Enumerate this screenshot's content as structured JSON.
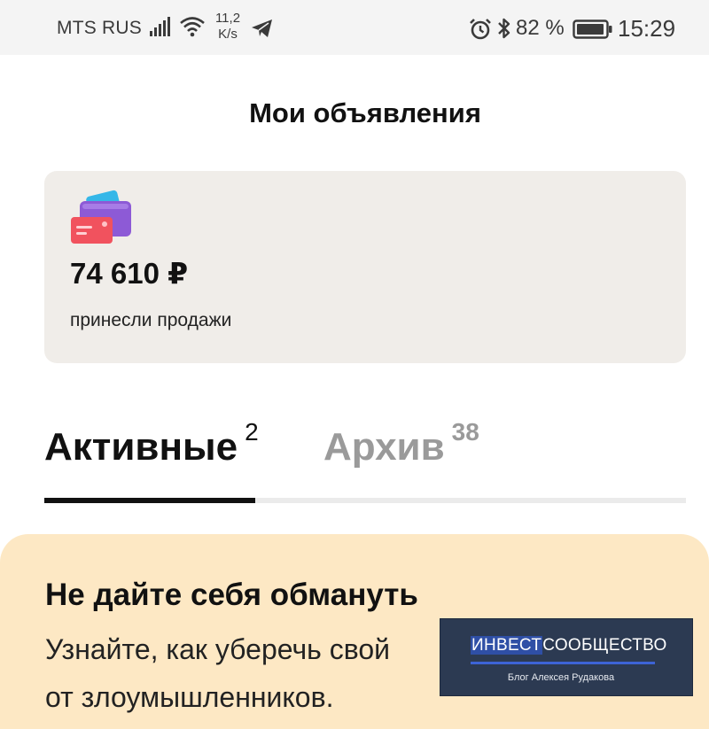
{
  "status_bar": {
    "carrier": "MTS RUS",
    "speed_value": "11,2",
    "speed_unit": "K/s",
    "battery": "82 %",
    "time": "15:29",
    "icons": [
      "signal-icon",
      "wifi-icon",
      "telegram-icon",
      "alarm-icon",
      "bluetooth-icon",
      "battery-icon"
    ]
  },
  "header": {
    "title": "Мои объявления"
  },
  "sales": {
    "icon": "wallet-cards-icon",
    "amount": "74 610 ₽",
    "caption": "принесли продажи"
  },
  "tabs": [
    {
      "label": "Активные",
      "count": "2",
      "active": true
    },
    {
      "label": "Архив",
      "count": "38",
      "active": false
    }
  ],
  "notice": {
    "title": "Не дайте себя обмануть",
    "line1": "Узнайте, как уберечь свой",
    "line2": "от злоумышленников."
  },
  "watermark": {
    "title_part1": "ИНВЕСТ",
    "title_part2": "СООБЩЕСТВО",
    "subtitle": "Блог Алексея Рудакова"
  },
  "colors": {
    "card_bg": "#f0ede9",
    "notice_bg": "#fde8c4",
    "tab_inactive": "#9a9a9a",
    "watermark_bg": "#2c3a52"
  }
}
